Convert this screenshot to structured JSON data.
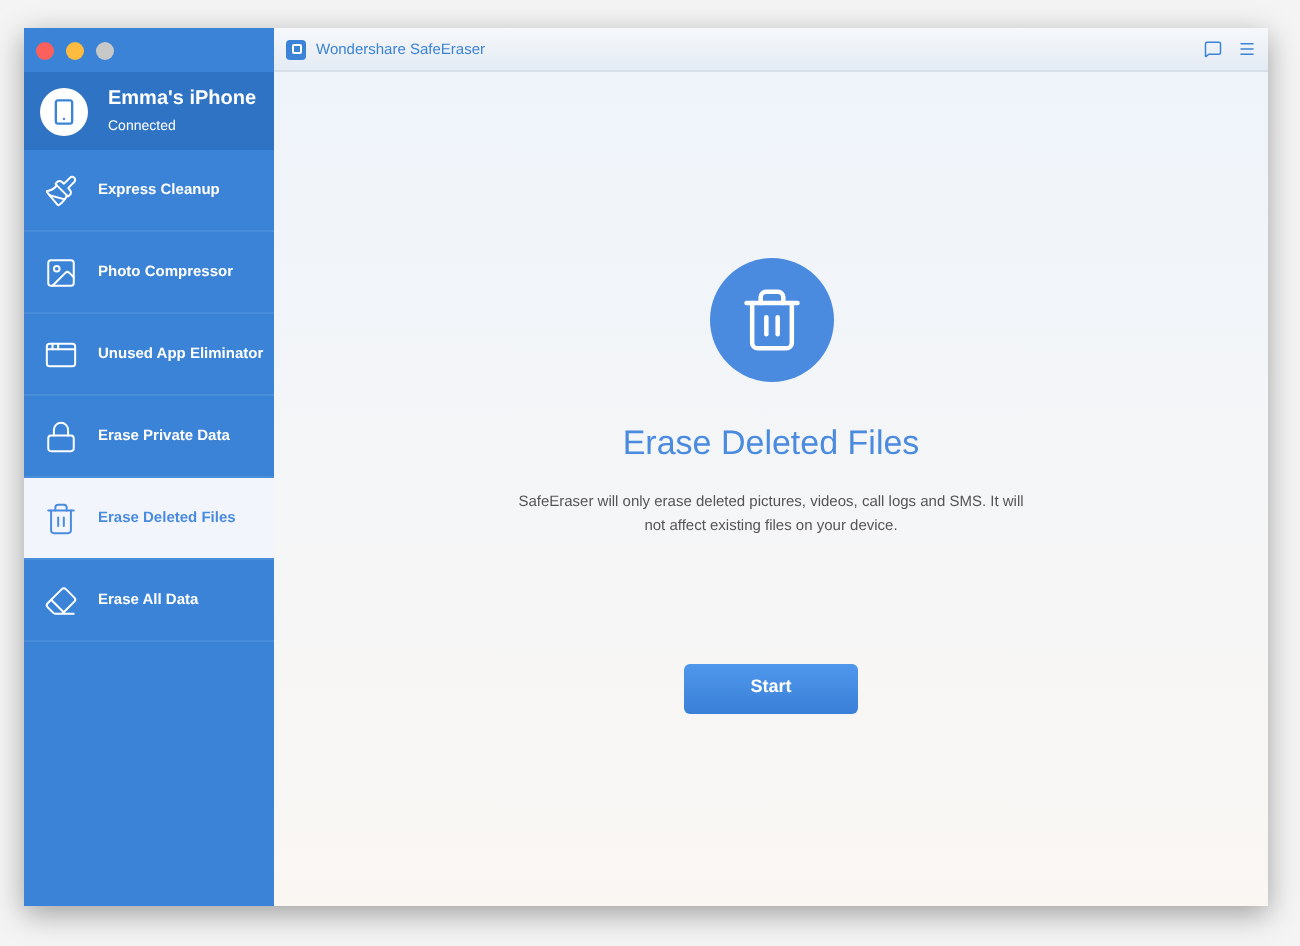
{
  "window": {
    "title": "Wondershare SafeEraser"
  },
  "device": {
    "name": "Emma's iPhone",
    "status": "Connected"
  },
  "sidebar": {
    "items": [
      {
        "label": "Express Cleanup",
        "kind": "cleanup",
        "selected": false
      },
      {
        "label": "Photo Compressor",
        "kind": "photo",
        "selected": false
      },
      {
        "label": "Unused App Eliminator",
        "kind": "app",
        "selected": false
      },
      {
        "label": "Erase Private Data",
        "kind": "private",
        "selected": false
      },
      {
        "label": "Erase Deleted Files",
        "kind": "deleted",
        "selected": true
      },
      {
        "label": "Erase All Data",
        "kind": "all",
        "selected": false
      }
    ]
  },
  "main": {
    "heading": "Erase Deleted Files",
    "description": "SafeEraser will only erase deleted pictures, videos, call logs and SMS. It will not affect existing files on your device.",
    "button": "Start"
  }
}
